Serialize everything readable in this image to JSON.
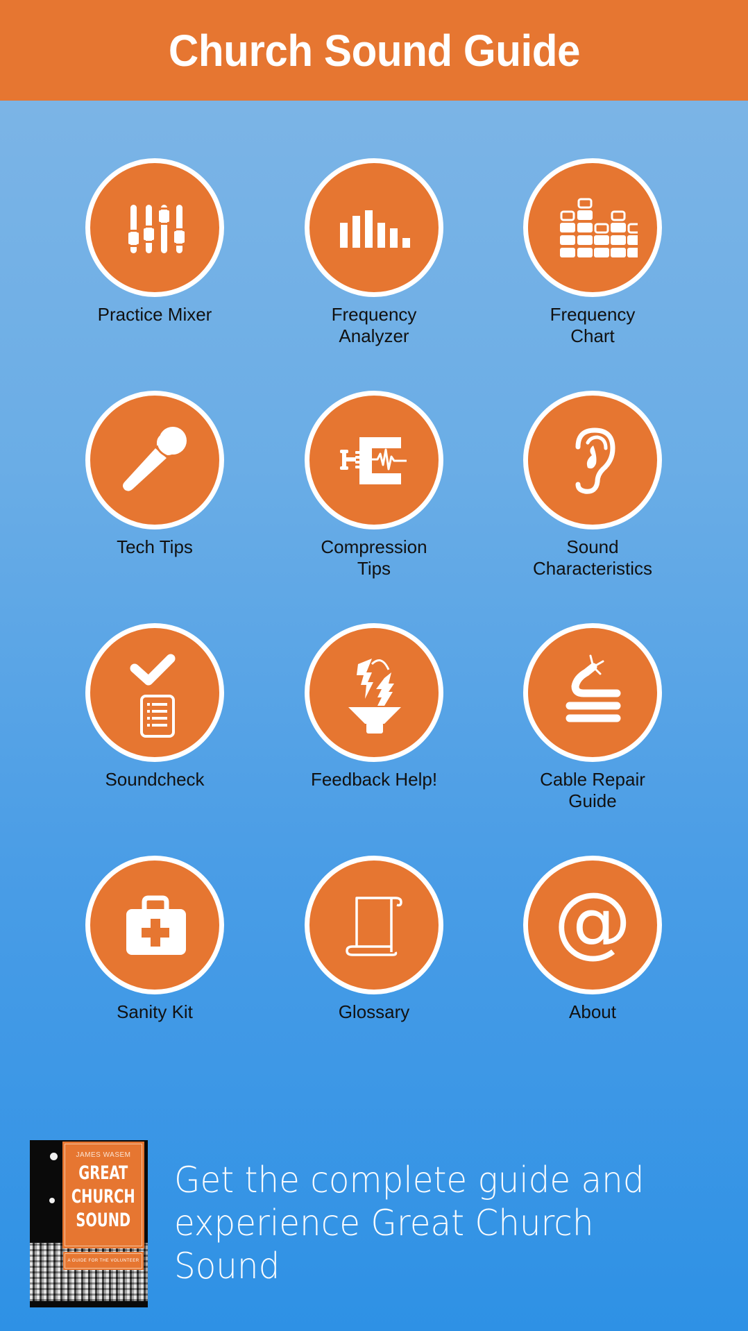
{
  "header": {
    "title": "Church Sound Guide"
  },
  "colors": {
    "accent": "#e67631",
    "background_top": "#80b6e6",
    "background_bottom": "#2e91e5",
    "label_text": "#111111"
  },
  "menu": {
    "items": [
      {
        "label": "Practice Mixer",
        "icon": "mixer-faders-icon"
      },
      {
        "label": "Frequency\nAnalyzer",
        "icon": "bar-graph-icon"
      },
      {
        "label": "Frequency\nChart",
        "icon": "equalizer-blocks-icon"
      },
      {
        "label": "Tech Tips",
        "icon": "microphone-icon"
      },
      {
        "label": "Compression\nTips",
        "icon": "compressor-clamp-icon"
      },
      {
        "label": "Sound\nCharacteristics",
        "icon": "ear-icon"
      },
      {
        "label": "Soundcheck",
        "icon": "checklist-icon"
      },
      {
        "label": "Feedback Help!",
        "icon": "speaker-feedback-icon"
      },
      {
        "label": "Cable Repair\nGuide",
        "icon": "coiled-cable-icon"
      },
      {
        "label": "Sanity Kit",
        "icon": "first-aid-kit-icon"
      },
      {
        "label": "Glossary",
        "icon": "scroll-icon"
      },
      {
        "label": "About",
        "icon": "at-sign-icon"
      }
    ]
  },
  "promo": {
    "book": {
      "author": "JAMES WASEM",
      "title": "GREAT\nCHURCH\nSOUND",
      "subtitle": "A GUIDE FOR THE VOLUNTEER"
    },
    "text": "Get the complete guide and\nexperience Great Church Sound"
  }
}
